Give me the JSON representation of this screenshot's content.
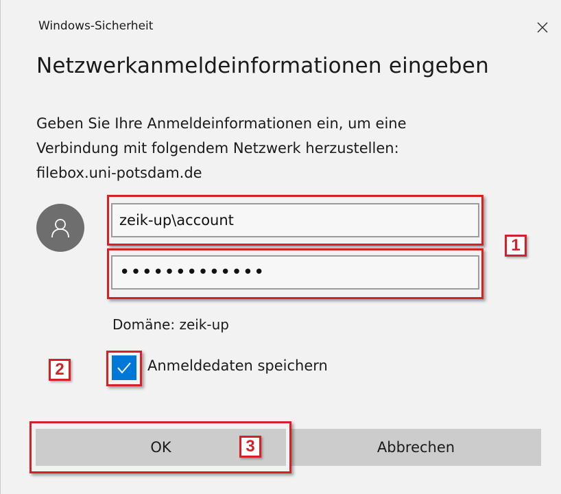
{
  "window": {
    "title": "Windows-Sicherheit",
    "close_icon": "close-icon"
  },
  "dialog": {
    "heading": "Netzwerkanmeldeinformationen eingeben",
    "message_lines": [
      "Geben Sie Ihre Anmeldeinformationen ein, um eine",
      "Verbindung mit folgendem Netzwerk herzustellen:",
      "filebox.uni-potsdam.de"
    ],
    "avatar_icon": "user-icon",
    "username_value": "zeik-up\\account",
    "password_value": "•••••••••••••",
    "domain_text": "Domäne: zeik-up",
    "remember_label": "Anmeldedaten speichern",
    "remember_checked": true,
    "ok_label": "OK",
    "cancel_label": "Abbrechen"
  },
  "annotations": {
    "label_1": "1",
    "label_2": "2",
    "label_3": "3",
    "color": "#d71f26"
  },
  "colors": {
    "accent": "#0078d7",
    "background": "#f2f2f2",
    "button": "#cccccc",
    "avatar": "#6e6e6e"
  }
}
